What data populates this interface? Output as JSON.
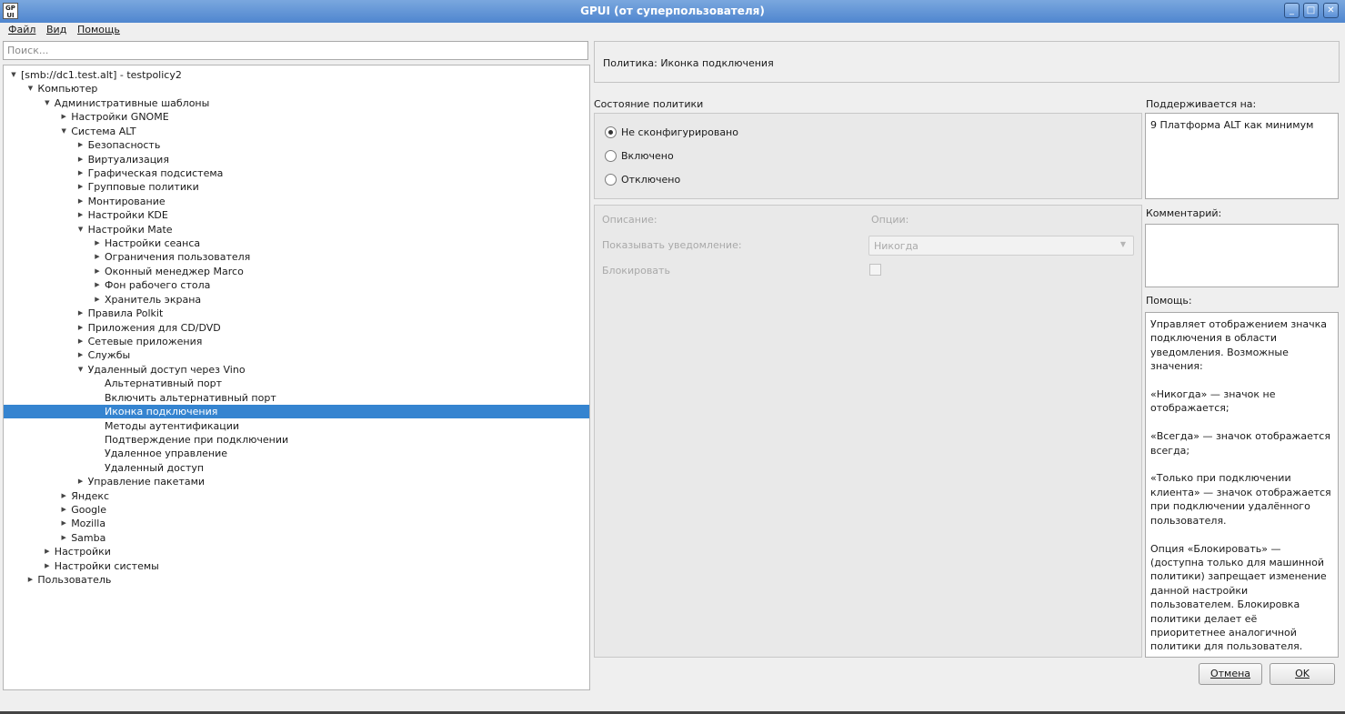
{
  "window": {
    "title": "GPUI (от суперпользователя)",
    "icon_text": "GP UI",
    "controls": [
      "minimize-icon",
      "maximize-icon",
      "close-icon"
    ]
  },
  "menu": [
    "Файл",
    "Вид",
    "Помощь"
  ],
  "search": {
    "placeholder": "Поиск...",
    "value": ""
  },
  "tree": [
    {
      "label": "[smb://dc1.test.alt] - testpolicy2",
      "level": 0,
      "arrow": "open"
    },
    {
      "label": "Компьютер",
      "level": 1,
      "arrow": "open"
    },
    {
      "label": "Административные шаблоны",
      "level": 2,
      "arrow": "open"
    },
    {
      "label": "Настройки GNOME",
      "level": 3,
      "arrow": "closed"
    },
    {
      "label": "Система ALT",
      "level": 3,
      "arrow": "open"
    },
    {
      "label": "Безопасность",
      "level": 4,
      "arrow": "closed"
    },
    {
      "label": "Виртуализация",
      "level": 4,
      "arrow": "closed"
    },
    {
      "label": "Графическая подсистема",
      "level": 4,
      "arrow": "closed"
    },
    {
      "label": "Групповые политики",
      "level": 4,
      "arrow": "closed"
    },
    {
      "label": "Монтирование",
      "level": 4,
      "arrow": "closed"
    },
    {
      "label": "Настройки KDE",
      "level": 4,
      "arrow": "closed"
    },
    {
      "label": "Настройки Mate",
      "level": 4,
      "arrow": "open"
    },
    {
      "label": "Настройки сеанса",
      "level": 5,
      "arrow": "closed"
    },
    {
      "label": "Ограничения пользователя",
      "level": 5,
      "arrow": "closed"
    },
    {
      "label": "Оконный менеджер Marco",
      "level": 5,
      "arrow": "closed"
    },
    {
      "label": "Фон рабочего стола",
      "level": 5,
      "arrow": "closed"
    },
    {
      "label": "Хранитель экрана",
      "level": 5,
      "arrow": "closed"
    },
    {
      "label": "Правила Polkit",
      "level": 4,
      "arrow": "closed"
    },
    {
      "label": "Приложения для CD/DVD",
      "level": 4,
      "arrow": "closed"
    },
    {
      "label": "Сетевые приложения",
      "level": 4,
      "arrow": "closed"
    },
    {
      "label": "Службы",
      "level": 4,
      "arrow": "closed"
    },
    {
      "label": "Удаленный доступ через Vino",
      "level": 4,
      "arrow": "open"
    },
    {
      "label": "Альтернативный порт",
      "level": 5,
      "arrow": "none"
    },
    {
      "label": "Включить альтернативный порт",
      "level": 5,
      "arrow": "none"
    },
    {
      "label": "Иконка подключения",
      "level": 5,
      "arrow": "none",
      "selected": true
    },
    {
      "label": "Методы аутентификации",
      "level": 5,
      "arrow": "none"
    },
    {
      "label": "Подтверждение при подключении",
      "level": 5,
      "arrow": "none"
    },
    {
      "label": "Удаленное управление",
      "level": 5,
      "arrow": "none"
    },
    {
      "label": "Удаленный доступ",
      "level": 5,
      "arrow": "none"
    },
    {
      "label": "Управление пакетами",
      "level": 4,
      "arrow": "closed"
    },
    {
      "label": "Яндекс",
      "level": 3,
      "arrow": "closed"
    },
    {
      "label": "Google",
      "level": 3,
      "arrow": "closed"
    },
    {
      "label": "Mozilla",
      "level": 3,
      "arrow": "closed"
    },
    {
      "label": "Samba",
      "level": 3,
      "arrow": "closed"
    },
    {
      "label": "Настройки",
      "level": 2,
      "arrow": "closed"
    },
    {
      "label": "Настройки системы",
      "level": 2,
      "arrow": "closed"
    },
    {
      "label": "Пользователь",
      "level": 1,
      "arrow": "closed"
    }
  ],
  "policy": {
    "header": "Политика: Иконка подключения",
    "state_label": "Состояние политики",
    "states": [
      {
        "label": "Не сконфигурировано",
        "checked": true
      },
      {
        "label": "Включено",
        "checked": false
      },
      {
        "label": "Отключено",
        "checked": false
      }
    ],
    "description_label": "Описание:",
    "options_label": "Опции:",
    "show_notification_label": "Показывать уведомление:",
    "show_notification_value": "Никогда",
    "block_label": "Блокировать",
    "block_checked": false
  },
  "side": {
    "supported_label": "Поддерживается на:",
    "supported_value": "9 Платформа ALT как минимум",
    "comment_label": "Комментарий:",
    "comment_value": "",
    "help_label": "Помощь:",
    "help_text": "Управляет отображением значка подключения в области уведомления. Возможные значения:\n\n«Никогда» — значок не отображается;\n\n«Всегда» — значок отображается всегда;\n\n«Только при подключении клиента» — значок отображается при подключении удалённого пользователя.\n\nОпция «Блокировать» — (доступна только для машинной политики) запрещает изменение данной настройки пользователем. Блокировка политики делает её приоритетнее аналогичной политики для пользователя."
  },
  "buttons": {
    "cancel": "Отмена",
    "ok": "OK"
  }
}
